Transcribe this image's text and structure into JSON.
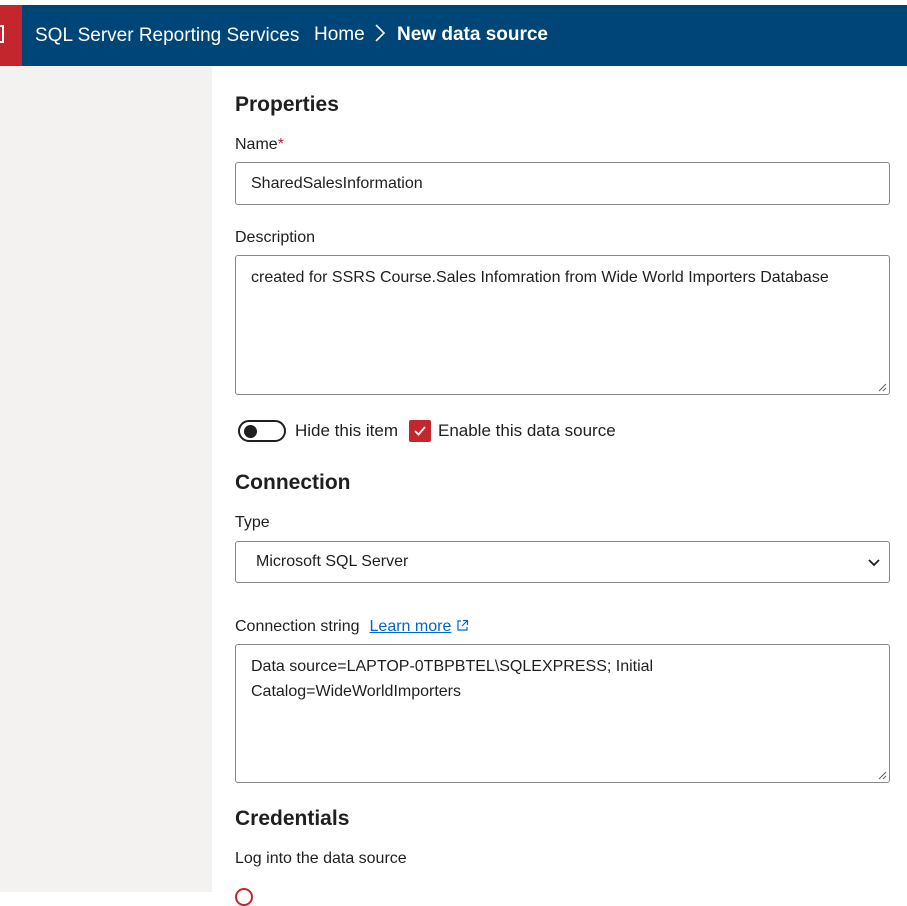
{
  "header": {
    "app_title": "SQL Server Reporting Services",
    "breadcrumb_home": "Home",
    "breadcrumb_current": "New data source"
  },
  "properties": {
    "heading": "Properties",
    "name_label": "Name",
    "required_marker": "*",
    "name_value": "SharedSalesInformation",
    "description_label": "Description",
    "description_value": "created for SSRS Course.Sales Infomration from Wide World Importers Database",
    "hide_item_label": "Hide this item",
    "hide_item_on": false,
    "enable_label": "Enable this data source",
    "enable_checked": true
  },
  "connection": {
    "heading": "Connection",
    "type_label": "Type",
    "type_value": "Microsoft SQL Server",
    "connection_string_label": "Connection string",
    "learn_more": "Learn more",
    "connection_string_line1": "Data source=LAPTOP-0TBPBTEL\\SQLEXPRESS; Initial",
    "connection_string_line2": "Catalog=WideWorldImporters"
  },
  "credentials": {
    "heading": "Credentials",
    "login_label": "Log into the data source"
  },
  "colors": {
    "header_bg": "#004578",
    "accent_red": "#c4262e",
    "sidebar_bg": "#f3f2f1",
    "link": "#0066cc"
  }
}
